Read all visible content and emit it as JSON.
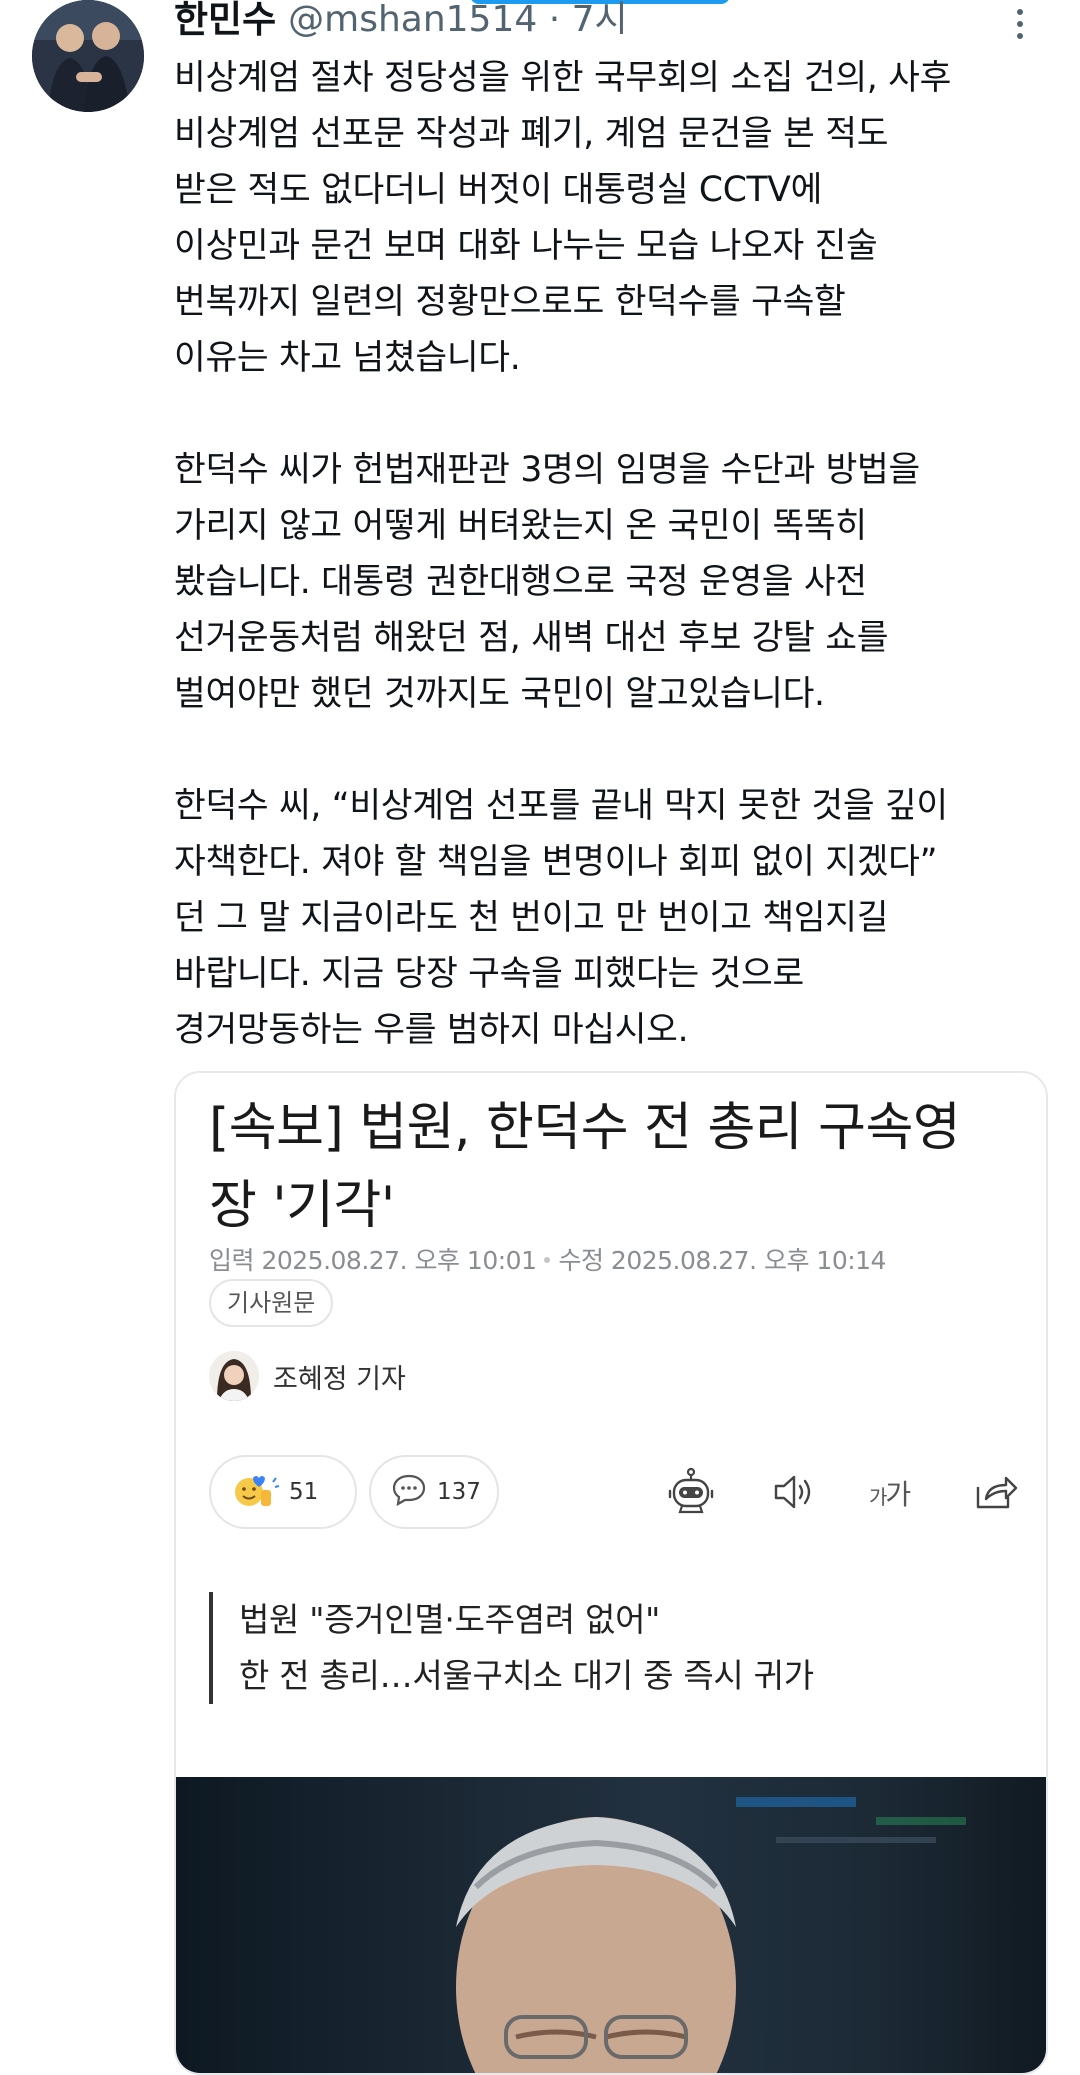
{
  "tweet": {
    "display_name": "한민수",
    "handle_time": "@mshan1514 · 7시",
    "paragraphs": [
      [
        "비상계엄 절차 정당성을 위한 국무회의 소집 건의, 사후",
        "비상계엄 선포문 작성과 폐기, 계엄 문건을 본 적도",
        "받은 적도 없다더니 버젓이 대통령실 CCTV에",
        "이상민과 문건 보며 대화 나누는 모습 나오자 진술",
        "번복까지 일련의 정황만으로도 한덕수를 구속할",
        "이유는 차고 넘쳤습니다."
      ],
      [
        "한덕수 씨가 헌법재판관 3명의 임명을 수단과 방법을",
        "가리지 않고 어떻게 버텨왔는지 온 국민이 똑똑히",
        "봤습니다. 대통령 권한대행으로 국정 운영을 사전",
        "선거운동처럼 해왔던 점, 새벽 대선 후보 강탈 쇼를",
        "벌여야만 했던 것까지도 국민이 알고있습니다."
      ],
      [
        "한덕수 씨, “비상계엄 선포를 끝내 막지 못한 것을 깊이",
        "자책한다. 져야 할 책임을 변명이나 회피 없이 지겠다”",
        "던 그 말 지금이라도 천 번이고 만 번이고 책임지길",
        "바랍니다. 지금 당장 구속을 피했다는 것으로",
        "경거망동하는 우를 범하지 마십시오."
      ]
    ]
  },
  "article": {
    "headline_lines": [
      "[속보] 법원, 한덕수 전 총리 구속영",
      "장 '기각'"
    ],
    "input_date": "입력 2025.08.27. 오후 10:01",
    "modified_date": "수정 2025.08.27. 오후 10:14",
    "source_button": "기사원문",
    "reporter": "조혜정 기자",
    "reaction_count": "51",
    "comment_count": "137",
    "font_size_label_small": "가",
    "font_size_label_large": "가",
    "subhead_lines": [
      "법원 \"증거인멸·도주염려 없어\"",
      "한 전 총리…서울구치소 대기 중 즉시 귀가"
    ]
  },
  "icons": {
    "more": "more-vertical-icon",
    "reaction": "emoji-reaction-icon",
    "comment": "comment-bubble-icon",
    "summary_bot": "robot-summary-icon",
    "audio": "speaker-icon",
    "share": "share-icon"
  },
  "colors": {
    "text": "#0f1419",
    "secondary": "#536471",
    "accent": "#1d9bf0",
    "card_border": "#e6e8eb"
  }
}
